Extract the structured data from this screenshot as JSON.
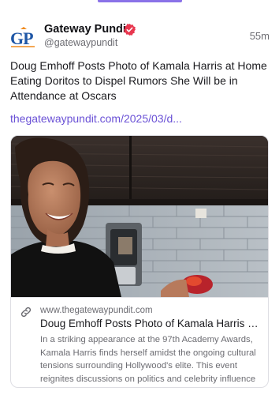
{
  "author": {
    "name": "Gateway Pundit",
    "handle": "@gatewaypundit",
    "avatar_text": "GP",
    "verified_icon": "verified-badge-icon",
    "verified_color": "#e8374f"
  },
  "post": {
    "time": "55m",
    "text": "Doug Emhoff Posts Photo of Kamala Harris at Home Eating Doritos to Dispel Rumors She Will be in Attendance at Oscars",
    "link": "thegatewaypundit.com/2025/03/d..."
  },
  "card": {
    "icon": "link-icon",
    "domain": "www.thegatewaypundit.com",
    "title": "Doug Emhoff Posts Photo of Kamala Harris at Home Eating Doritos to Dispel Rumors She Will be in Attendance at Oscars",
    "description_lines": [
      "In a striking appearance at the 97th Academy Awards,",
      "Kamala Harris finds herself amidst the ongoing cultural",
      "tensions surrounding Hollywood's elite. This event",
      "reignites discussions on politics and celebrity influence"
    ]
  },
  "colors": {
    "accent": "#6a51d6",
    "tab_indicator": "#8a72e8",
    "brand_blue": "#1f57a6",
    "brand_orange": "#f08a1c"
  }
}
